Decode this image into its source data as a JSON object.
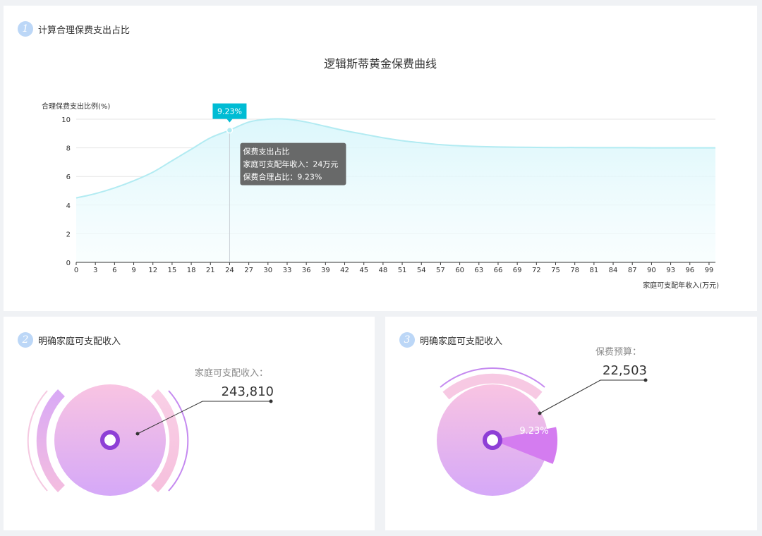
{
  "sections": [
    {
      "number": "1",
      "title": "计算合理保费支出占比"
    },
    {
      "number": "2",
      "title": "明确家庭可支配收入"
    },
    {
      "number": "3",
      "title": "明确家庭可支配收入"
    }
  ],
  "chart_data": {
    "type": "area",
    "title": "逻辑斯蒂黄金保费曲线",
    "ylabel": "合理保费支出比例(%)",
    "xlabel": "家庭可支配年收入(万元)",
    "ylim": [
      0,
      10
    ],
    "yticks": [
      "0",
      "2",
      "4",
      "6",
      "8",
      "10"
    ],
    "xlim": [
      0,
      100
    ],
    "xticks": [
      "0",
      "3",
      "6",
      "9",
      "12",
      "15",
      "18",
      "21",
      "24",
      "27",
      "30",
      "33",
      "36",
      "39",
      "42",
      "45",
      "48",
      "51",
      "54",
      "57",
      "60",
      "63",
      "66",
      "69",
      "72",
      "75",
      "78",
      "81",
      "84",
      "87",
      "90",
      "93",
      "96",
      "99"
    ],
    "grid": true,
    "series": [
      {
        "x": [
          0,
          3,
          6,
          9,
          12,
          15,
          18,
          21,
          24,
          27,
          30,
          33,
          36,
          39,
          42,
          45,
          48,
          51,
          54,
          57,
          60,
          63,
          66,
          69,
          72,
          75,
          78,
          81,
          84,
          87,
          90,
          93,
          96,
          99
        ],
        "y": [
          4.5,
          4.8,
          5.2,
          5.7,
          6.3,
          7.1,
          7.9,
          8.7,
          9.23,
          9.8,
          10.0,
          10.0,
          9.8,
          9.5,
          9.2,
          8.95,
          8.7,
          8.5,
          8.35,
          8.22,
          8.14,
          8.09,
          8.06,
          8.04,
          8.03,
          8.02,
          8.02,
          8.01,
          8.01,
          8.01,
          8.0,
          8.0,
          8.0,
          8.0
        ]
      }
    ],
    "marker": {
      "x": 24,
      "y": 9.23,
      "label": "9.23%"
    },
    "tooltip": {
      "title": "保费支出占比",
      "line1": "家庭可支配年收入：24万元",
      "line2": "保费合理占比：9.23%"
    },
    "colors": {
      "line": "#b2ebf2",
      "fill": "#e0f7fa",
      "marker": "#00bcd4",
      "tooltip_bg": "#616161"
    }
  },
  "income_gauge": {
    "label": "家庭可支配收入：",
    "value": "243,810"
  },
  "premium_gauge": {
    "label": "保费预算：",
    "value": "22,503",
    "percent_label": "9.23%",
    "fraction": 0.0923
  },
  "colors": {
    "badge": "#bcd7f7",
    "pink": "#f7c6e3",
    "lavender": "#d3a6f3",
    "purple": "#8e3fd6",
    "slice": "#d47cf0"
  }
}
